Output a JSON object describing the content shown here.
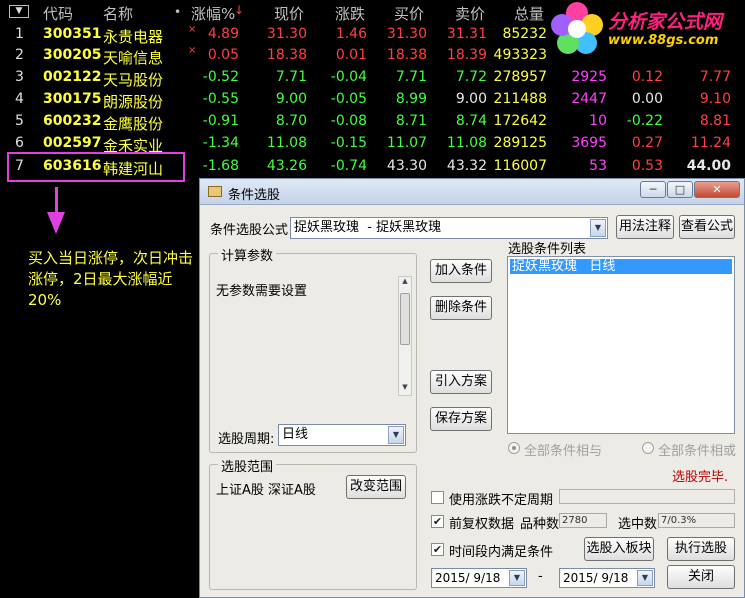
{
  "table": {
    "sort_icon": "triangle-down-icon",
    "headers": {
      "code": "代码",
      "name": "名称",
      "dot": "•",
      "pct": "涨幅%",
      "pct_arrow": "↓",
      "price": "现价",
      "change": "涨跌",
      "bid": "买价",
      "ask": "卖价",
      "volume": "总量"
    },
    "rows": [
      {
        "idx": "1",
        "code": "300351",
        "name": "永贵电器",
        "flag": "×",
        "pct": "4.89",
        "price": "31.30",
        "change": "1.46",
        "bid": "31.30",
        "ask": "31.31",
        "volume": "85232",
        "c6": "",
        "c7": "",
        "c8": ""
      },
      {
        "idx": "2",
        "code": "300205",
        "name": "天喻信息",
        "flag": "×",
        "pct": "0.05",
        "price": "18.38",
        "change": "0.01",
        "bid": "18.38",
        "ask": "18.39",
        "volume": "493323",
        "c6": "",
        "c7": "",
        "c8": ""
      },
      {
        "idx": "3",
        "code": "002122",
        "name": "天马股份",
        "flag": "",
        "pct": "-0.52",
        "price": "7.71",
        "change": "-0.04",
        "bid": "7.71",
        "ask": "7.72",
        "volume": "278957",
        "c6": "2925",
        "c7": "0.12",
        "c8": "7.77"
      },
      {
        "idx": "4",
        "code": "300175",
        "name": "朗源股份",
        "flag": "",
        "pct": "-0.55",
        "price": "9.00",
        "change": "-0.05",
        "bid": "8.99",
        "ask": "9.00",
        "volume": "211488",
        "c6": "2447",
        "c7": "0.00",
        "c8": "9.10"
      },
      {
        "idx": "5",
        "code": "600232",
        "name": "金鹰股份",
        "flag": "",
        "pct": "-0.91",
        "price": "8.70",
        "change": "-0.08",
        "bid": "8.71",
        "ask": "8.74",
        "volume": "172642",
        "c6": "10",
        "c7": "-0.22",
        "c8": "8.81"
      },
      {
        "idx": "6",
        "code": "002597",
        "name": "金禾实业",
        "flag": "",
        "pct": "-1.34",
        "price": "11.08",
        "change": "-0.15",
        "bid": "11.07",
        "ask": "11.08",
        "volume": "289125",
        "c6": "3695",
        "c7": "0.27",
        "c8": "11.24"
      },
      {
        "idx": "7",
        "code": "603616",
        "name": "韩建河山",
        "flag": "",
        "pct": "-1.68",
        "price": "43.26",
        "change": "-0.74",
        "bid": "43.30",
        "ask": "43.32",
        "volume": "116007",
        "c6": "53",
        "c7": "0.53",
        "c8": "44.00"
      }
    ]
  },
  "annotation": {
    "note": "买入当日涨停，次日冲击涨停，2日最大涨幅近20%"
  },
  "logo": {
    "icon": "flower-logo-icon",
    "text": "分析家公式网",
    "url": "www.88gs.com"
  },
  "dialog": {
    "title": "条件选股",
    "title_icon": "folder-icon",
    "minimize": "─",
    "maximize": "□",
    "close": "✕",
    "formula_label": "条件选股公式",
    "formula_value": "捉妖黑玫瑰  - 捉妖黑玫瑰",
    "usage_button": "用法注释",
    "view_button": "查看公式",
    "params_group": "计算参数",
    "params_text": "无参数需要设置",
    "period_label": "选股周期:",
    "period_value": "日线",
    "range_group": "选股范围",
    "range_text": "上证A股 深证A股",
    "change_range_button": "改变范围",
    "add_button": "加入条件",
    "delete_button": "删除条件",
    "import_button": "引入方案",
    "save_button": "保存方案",
    "conditions_label": "选股条件列表",
    "conditions": [
      "捉妖黑玫瑰   日线"
    ],
    "radio_and": "全部条件相与",
    "radio_or": "全部条件相或",
    "status": "选股完毕.",
    "use_unfixed_period": "使用涨跌不定周期",
    "adjusted_data": "前复权数据",
    "count_label": "品种数",
    "count_value": "2780",
    "hit_label": "选中数",
    "hit_value": "7/0.3%",
    "time_cond": "时间段内满足条件",
    "to_block_button": "选股入板块",
    "run_button": "执行选股",
    "date_from": "2015/ 9/18",
    "date_sep": "-",
    "date_to": "2015/ 9/18",
    "close_button": "关闭",
    "colors": {
      "status": "#c00000",
      "selection": "#3399ff"
    }
  }
}
